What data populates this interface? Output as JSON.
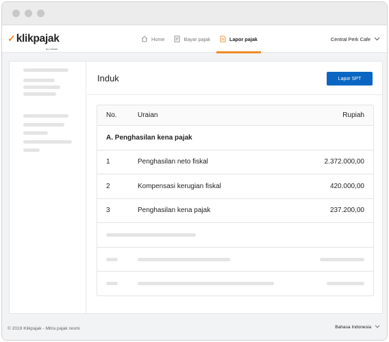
{
  "app": {
    "logo_text": "klikpajak",
    "logo_mark": "✓",
    "logo_sub": "by mekari"
  },
  "nav": {
    "items": [
      {
        "label": "Home",
        "icon": "home-icon",
        "active": false
      },
      {
        "label": "Bayar pajak",
        "icon": "document-icon",
        "active": false
      },
      {
        "label": "Lapor pajak",
        "icon": "report-icon",
        "active": true
      }
    ],
    "company": "Central Perk Cafe"
  },
  "main": {
    "title": "Induk",
    "primary_button": "Lapor SPT",
    "table": {
      "headers": {
        "no": "No.",
        "desc": "Uraian",
        "amount": "Rupiah"
      },
      "section": "A. Penghasilan kena pajak",
      "rows": [
        {
          "no": "1",
          "desc": "Penghasilan neto fiskal",
          "amount": "2.372.000,00"
        },
        {
          "no": "2",
          "desc": "Kompensasi kerugian fiskal",
          "amount": "420.000,00"
        },
        {
          "no": "3",
          "desc": "Penghasilan kena pajak",
          "amount": "237.200,00"
        }
      ]
    }
  },
  "footer": {
    "copyright": "© 2019 Klikpajak - Mitra pajak resmi",
    "language": "Bahasa Indonesia"
  },
  "colors": {
    "accent": "#f08a24",
    "primary": "#0a66c2",
    "background": "#f2f3f5"
  }
}
